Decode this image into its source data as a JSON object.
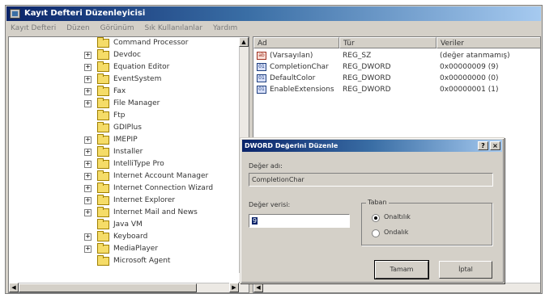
{
  "window": {
    "title": "Kayıt Defteri Düzenleyicisi"
  },
  "menu": [
    "Kayıt Defteri",
    "Düzen",
    "Görünüm",
    "Sık Kullanılanlar",
    "Yardım"
  ],
  "tree": {
    "items": [
      {
        "label": "Command Processor",
        "expander": ""
      },
      {
        "label": "Devdoc",
        "expander": "+"
      },
      {
        "label": "Equation Editor",
        "expander": "+"
      },
      {
        "label": "EventSystem",
        "expander": "+"
      },
      {
        "label": "Fax",
        "expander": "+"
      },
      {
        "label": "File Manager",
        "expander": "+"
      },
      {
        "label": "Ftp",
        "expander": ""
      },
      {
        "label": "GDIPlus",
        "expander": ""
      },
      {
        "label": "IMEPIP",
        "expander": "+"
      },
      {
        "label": "Installer",
        "expander": "+"
      },
      {
        "label": "IntelliType Pro",
        "expander": "+"
      },
      {
        "label": "Internet Account Manager",
        "expander": "+"
      },
      {
        "label": "Internet Connection Wizard",
        "expander": "+"
      },
      {
        "label": "Internet Explorer",
        "expander": "+"
      },
      {
        "label": "Internet Mail and News",
        "expander": "+"
      },
      {
        "label": "Java VM",
        "expander": ""
      },
      {
        "label": "Keyboard",
        "expander": "+"
      },
      {
        "label": "MediaPlayer",
        "expander": "+"
      },
      {
        "label": "Microsoft Agent",
        "expander": ""
      }
    ]
  },
  "list": {
    "columns": [
      "Ad",
      "Tür",
      "Veriler"
    ],
    "rows": [
      {
        "name": "(Varsayılan)",
        "type": "REG_SZ",
        "data": "(değer atanmamış)",
        "icon": "string-value-icon"
      },
      {
        "name": "CompletionChar",
        "type": "REG_DWORD",
        "data": "0x00000009 (9)",
        "icon": "dword-value-icon"
      },
      {
        "name": "DefaultColor",
        "type": "REG_DWORD",
        "data": "0x00000000 (0)",
        "icon": "dword-value-icon"
      },
      {
        "name": "EnableExtensions",
        "type": "REG_DWORD",
        "data": "0x00000001 (1)",
        "icon": "dword-value-icon"
      }
    ]
  },
  "dialog": {
    "title": "DWORD Değerini Düzenle",
    "help_label": "?",
    "close_label": "×",
    "value_name_label": "Değer adı:",
    "value_name": "CompletionChar",
    "value_data_label": "Değer verisi:",
    "value_data": "9",
    "base_label": "Taban",
    "radio_hex": "Onaltılık",
    "radio_dec": "Ondalık",
    "ok_label": "Tamam",
    "cancel_label": "İptal"
  }
}
